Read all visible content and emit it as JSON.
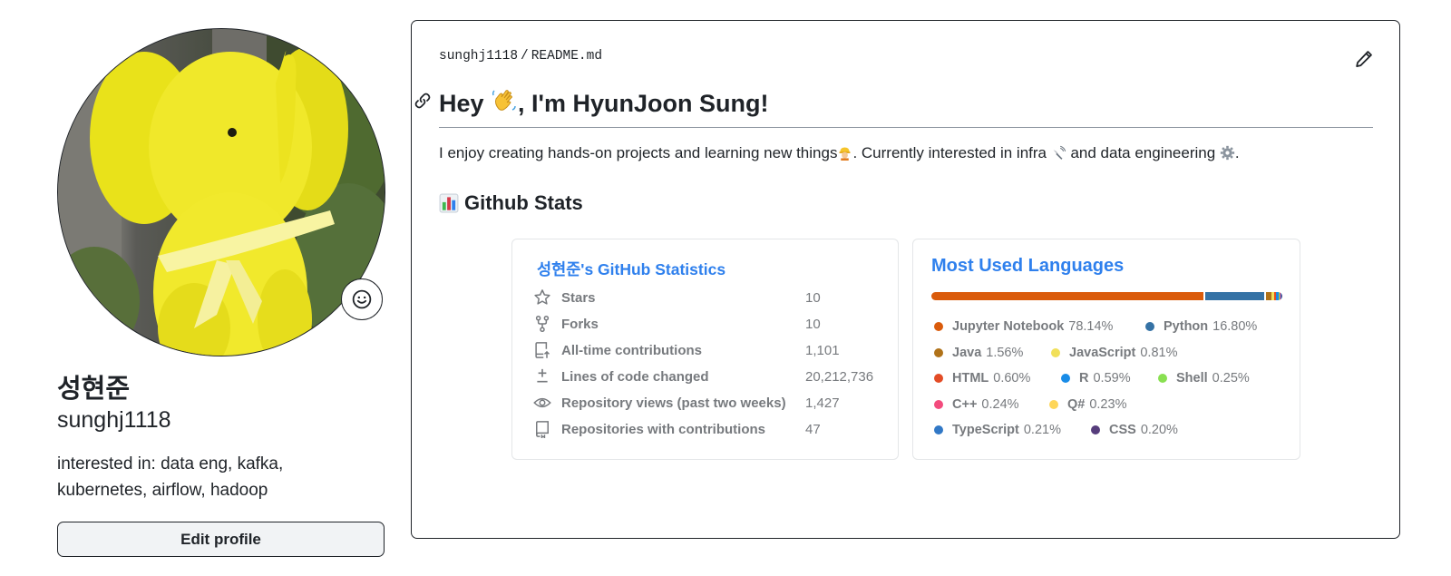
{
  "profile": {
    "display_name": "성현준",
    "login": "sunghj1118",
    "bio": "interested in: data eng, kafka, kubernetes, airflow, hadoop",
    "edit_button": "Edit profile"
  },
  "readme": {
    "path_user": "sunghj1118",
    "path_sep": "/",
    "path_file": "README.md",
    "heading_pre": "Hey ",
    "heading_post": ", I'm HyunJoon Sung!",
    "para_a": "I enjoy creating hands-on projects and learning new things",
    "para_b": ". Currently interested in infra ",
    "para_c": " and data engineering ",
    "para_d": ".",
    "section_title": "Github Stats"
  },
  "stats_card": {
    "title": "성현준's GitHub Statistics",
    "rows": [
      {
        "icon": "star-icon",
        "label": "Stars",
        "value": "10"
      },
      {
        "icon": "fork-icon",
        "label": "Forks",
        "value": "10"
      },
      {
        "icon": "contributions-icon",
        "label": "All-time contributions",
        "value": "1,101"
      },
      {
        "icon": "diff-icon",
        "label": "Lines of code changed",
        "value": "20,212,736"
      },
      {
        "icon": "eye-icon",
        "label": "Repository views (past two weeks)",
        "value": "1,427"
      },
      {
        "icon": "repo-icon",
        "label": "Repositories with contributions",
        "value": "47"
      }
    ]
  },
  "languages_card": {
    "title": "Most Used Languages",
    "languages": [
      {
        "name": "Jupyter Notebook",
        "percent": "78.14%",
        "value": 78.14,
        "color": "#DA5B0B"
      },
      {
        "name": "Python",
        "percent": "16.80%",
        "value": 16.8,
        "color": "#3572A5"
      },
      {
        "name": "Java",
        "percent": "1.56%",
        "value": 1.56,
        "color": "#b07219"
      },
      {
        "name": "JavaScript",
        "percent": "0.81%",
        "value": 0.81,
        "color": "#f1e05a"
      },
      {
        "name": "HTML",
        "percent": "0.60%",
        "value": 0.6,
        "color": "#e34c26"
      },
      {
        "name": "R",
        "percent": "0.59%",
        "value": 0.59,
        "color": "#198CE7"
      },
      {
        "name": "Shell",
        "percent": "0.25%",
        "value": 0.25,
        "color": "#89e051"
      },
      {
        "name": "C++",
        "percent": "0.24%",
        "value": 0.24,
        "color": "#f34b7d"
      },
      {
        "name": "Q#",
        "percent": "0.23%",
        "value": 0.23,
        "color": "#fed659"
      },
      {
        "name": "TypeScript",
        "percent": "0.21%",
        "value": 0.21,
        "color": "#3178c6"
      },
      {
        "name": "CSS",
        "percent": "0.20%",
        "value": 0.2,
        "color": "#563d7c"
      }
    ]
  }
}
